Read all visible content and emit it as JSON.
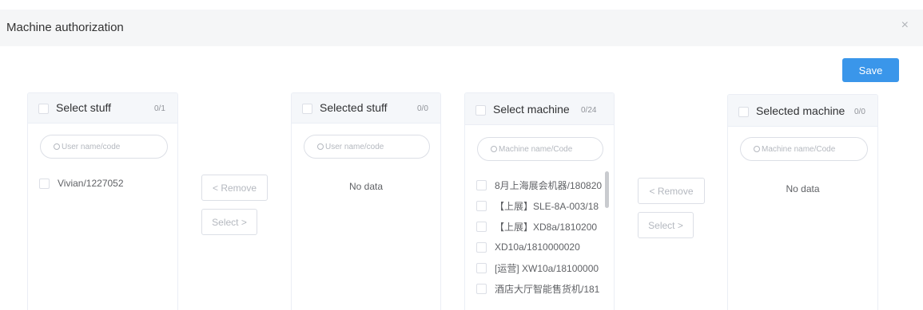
{
  "header": {
    "title": "Machine authorization",
    "close_glyph": "×"
  },
  "toolbar": {
    "save_label": "Save"
  },
  "staff_source": {
    "title": "Select stuff",
    "count": "0/1",
    "search_placeholder": "User name/code",
    "items": [
      "Vivian/1227052"
    ]
  },
  "staff_target": {
    "title": "Selected stuff",
    "count": "0/0",
    "search_placeholder": "User name/code",
    "empty_text": "No data"
  },
  "staff_transfer": {
    "remove_label": "< Remove",
    "select_label": "Select >"
  },
  "machine_source": {
    "title": "Select machine",
    "count": "0/24",
    "search_placeholder": "Machine name/Code",
    "items": [
      "8月上海展会机器/180820",
      "【上展】SLE-8A-003/18",
      "【上展】XD8a/1810200",
      "XD10a/1810000020",
      "[运营] XW10a/18100000",
      "酒店大厅智能售货机/181"
    ]
  },
  "machine_target": {
    "title": "Selected machine",
    "count": "0/0",
    "search_placeholder": "Machine name/Code",
    "empty_text": "No data"
  },
  "machine_transfer": {
    "remove_label": "< Remove",
    "select_label": "Select >"
  },
  "colors": {
    "primary": "#3a96ea",
    "header_bg": "#f5f6f7",
    "panel_head_bg": "#f5f7fa",
    "border": "#ebeef5"
  },
  "icons": {
    "close": "close-icon",
    "search": "search-icon",
    "checkbox": "checkbox-icon"
  }
}
